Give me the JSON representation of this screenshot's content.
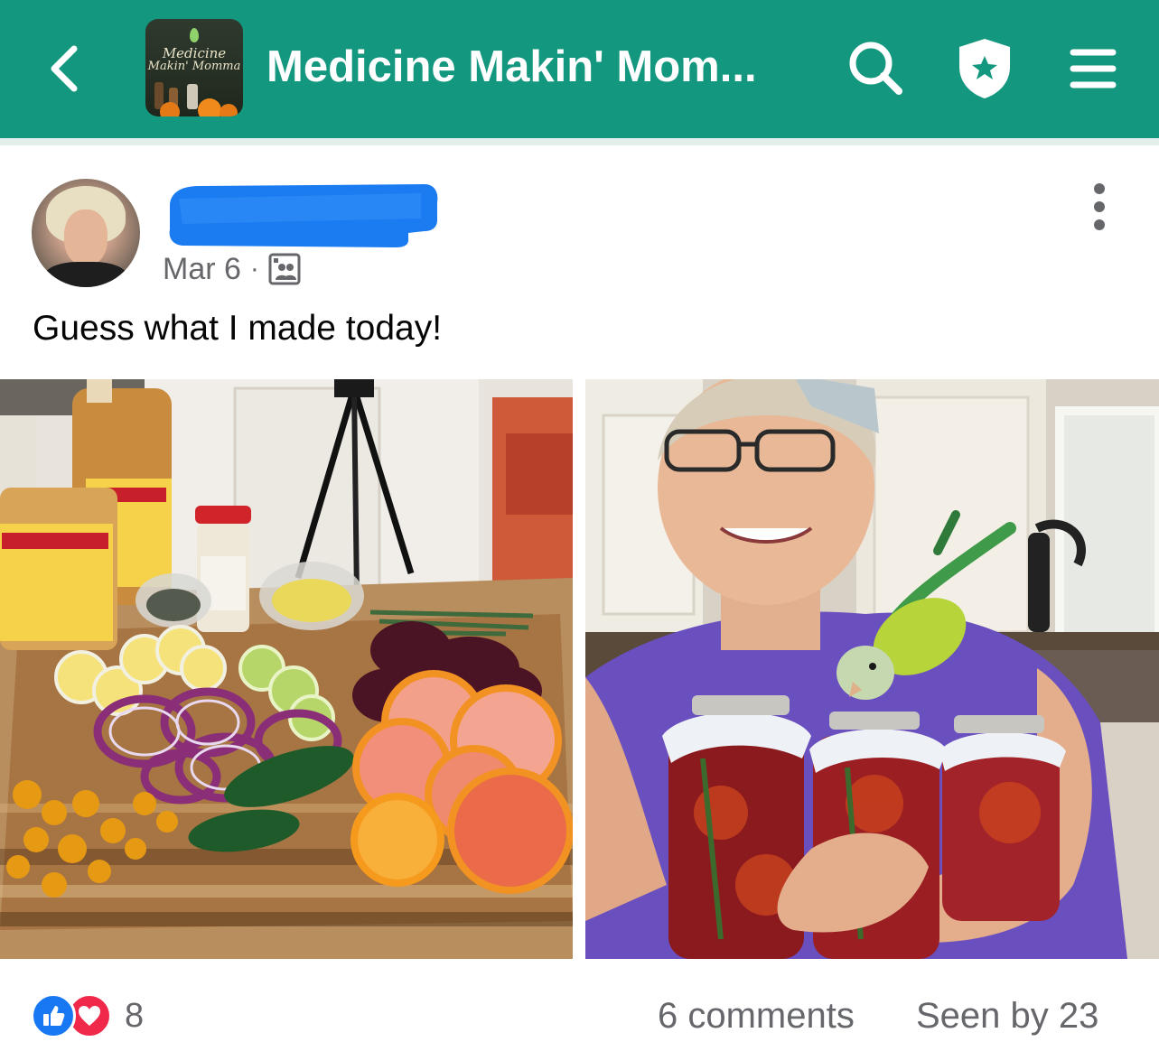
{
  "header": {
    "group_name": "Medicine Makin' Mom...",
    "logo_text_line1": "Medicine",
    "logo_text_line2": "Makin' Momma",
    "background_color": "#14977f",
    "icons": [
      "back-arrow-icon",
      "search-icon",
      "shield-star-icon",
      "menu-icon"
    ]
  },
  "post": {
    "author_name_redacted": true,
    "date": "Mar 6",
    "separator": "·",
    "audience_icon": "group-members-icon",
    "text": "Guess what I made today!",
    "photos": [
      {
        "name": "ingredients-photo"
      },
      {
        "name": "jars-with-parrot-photo"
      }
    ]
  },
  "footer": {
    "reaction_icons": [
      "like-icon",
      "love-icon"
    ],
    "reaction_count": "8",
    "comments": "6 comments",
    "seen_by": "Seen by 23"
  }
}
